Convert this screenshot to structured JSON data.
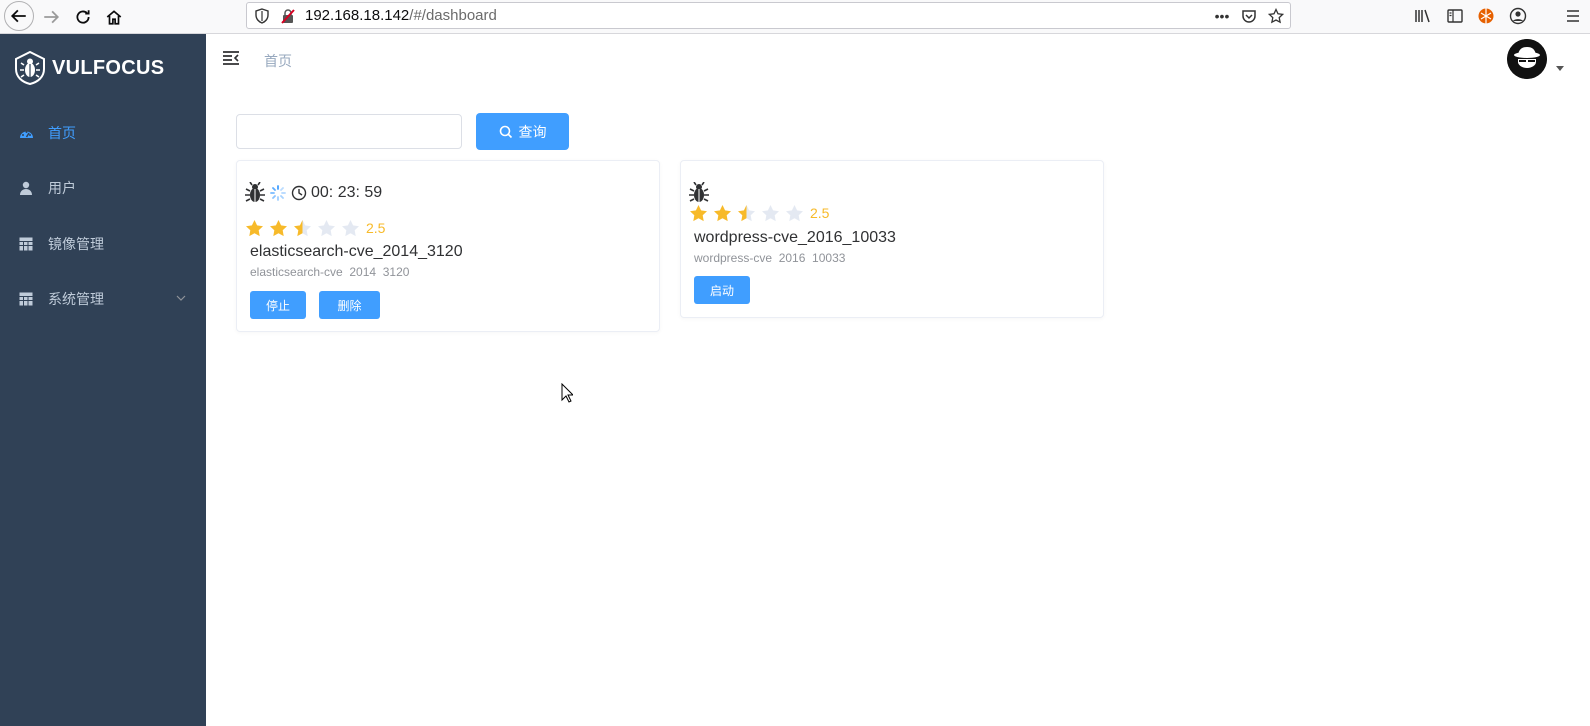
{
  "browser": {
    "url_host": "192.168.18.142",
    "url_path": "/#/dashboard",
    "icons": [
      "back-icon",
      "forward-icon",
      "reload-icon",
      "home-icon",
      "shield-icon",
      "insecure-lock-icon",
      "more-icon",
      "pocket-icon",
      "bookmark-star-icon",
      "library-icon",
      "sidebar-icon",
      "extension-icon",
      "account-icon",
      "menu-icon"
    ]
  },
  "sidebar": {
    "logo_text": "VULFOCUS",
    "items": [
      {
        "label": "首页",
        "icon": "dashboard-icon",
        "active": true
      },
      {
        "label": "用户",
        "icon": "user-icon",
        "active": false
      },
      {
        "label": "镜像管理",
        "icon": "table-icon",
        "active": false
      },
      {
        "label": "系统管理",
        "icon": "table-icon",
        "active": false,
        "expandable": true
      }
    ]
  },
  "navbar": {
    "breadcrumb": "首页"
  },
  "search": {
    "value": "",
    "placeholder": "",
    "button_label": "查询"
  },
  "cards": [
    {
      "timer": "00: 23: 59",
      "rating": 2.5,
      "rating_text": "2.5",
      "title": "elasticsearch-cve_2014_3120",
      "desc": "elasticsearch-cve  2014  3120",
      "buttons": [
        "停止",
        "删除"
      ]
    },
    {
      "rating": 2.5,
      "rating_text": "2.5",
      "title": "wordpress-cve_2016_10033",
      "desc": "wordpress-cve  2016  10033",
      "buttons": [
        "启动"
      ]
    }
  ],
  "colors": {
    "sidebar_bg": "#304156",
    "sidebar_text": "#bfcbd9",
    "accent": "#409eff",
    "star": "#f7ba2a",
    "star_empty": "#e4e9f2"
  }
}
